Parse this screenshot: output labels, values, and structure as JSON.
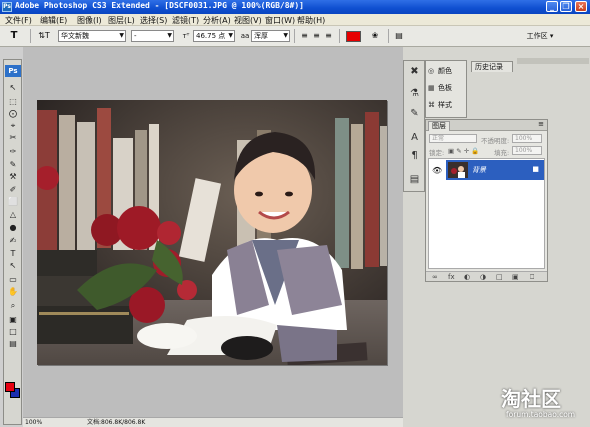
{
  "window": {
    "title": "Adobe Photoshop CS3 Extended - [DSCF0031.JPG @ 100%(RGB/8#)]",
    "app_badge": "Ps",
    "minimize": "_",
    "restore": "❐",
    "close": "×"
  },
  "menu": {
    "items": [
      "文件(F)",
      "编辑(E)",
      "图像(I)",
      "图层(L)",
      "选择(S)",
      "滤镜(T)",
      "分析(A)",
      "视图(V)",
      "窗口(W)",
      "帮助(H)"
    ]
  },
  "options": {
    "tool_glyph": "T",
    "orient_glyph": "⇅T",
    "font_family": "华文新魏",
    "font_style": "-",
    "size_icon": "ᴛᵀ",
    "font_size": "46.75 点",
    "aa_icon": "aa",
    "antialias": "浑厚",
    "align_left": "≡",
    "align_center": "≡",
    "align_right": "≡",
    "text_color": "#e60000",
    "warp_glyph": "❀",
    "panel_glyph": "▤",
    "workspace_label": "工作区 ▾"
  },
  "toolbox": {
    "badge": "Ps",
    "tools": [
      "↖",
      "⬚",
      "⨀",
      "⌖",
      "✂",
      "✑",
      "✎",
      "⚒",
      "✐",
      "⬜",
      "△",
      "●",
      "✍",
      "T",
      "↖",
      "▭",
      "✋",
      "⌕",
      "▣",
      "□",
      "▤"
    ],
    "foreground": "#e60012",
    "background": "#1a2db0"
  },
  "document": {
    "zoom": "100%",
    "status": "文档:806.8K/806.8K"
  },
  "panels": {
    "mini": [
      {
        "icon": "◎",
        "label": "颜色"
      },
      {
        "icon": "▦",
        "label": "色板"
      },
      {
        "icon": "⌘",
        "label": "样式"
      }
    ],
    "history_tab": "历史记录",
    "layers_tab": "图层",
    "blend_mode": "正常",
    "opacity_label": "不透明度:",
    "opacity_value": "100%",
    "lock_label": "锁定:",
    "fill_label": "填充:",
    "fill_value": "100%",
    "layer_name": "背景",
    "bottom_icons": [
      "∞",
      "fx",
      "◐",
      "◑",
      "□",
      "▣",
      "⎕"
    ]
  },
  "watermark": {
    "big": "淘社区",
    "small": "forum.taobao.com"
  }
}
